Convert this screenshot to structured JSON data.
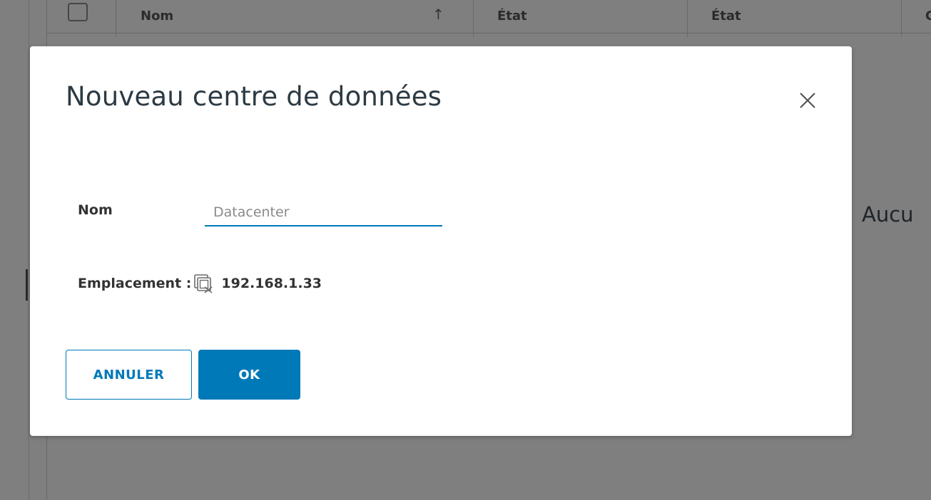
{
  "background": {
    "columns": {
      "name": "Nom",
      "state": "État",
      "status": "État",
      "partial": "C"
    },
    "empty_message": "Aucu"
  },
  "dialog": {
    "title": "Nouveau centre de données",
    "name_label": "Nom",
    "name_value": "",
    "name_placeholder": "Datacenter",
    "location_label": "Emplacement :",
    "location_icon": "vcenter-host-icon",
    "location_value": "192.168.1.33",
    "cancel_label": "ANNULER",
    "ok_label": "OK"
  },
  "colors": {
    "accent": "#0079b8",
    "overlay": "rgba(0,0,0,0.5)",
    "title_text": "#2c3a43"
  }
}
